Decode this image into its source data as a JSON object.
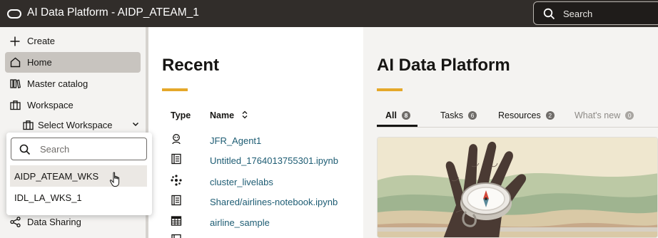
{
  "header": {
    "app_title": "AI Data Platform - AIDP_ATEAM_1",
    "search_placeholder": "Search"
  },
  "sidebar": {
    "items": [
      {
        "label": "Create",
        "icon": "plus-icon"
      },
      {
        "label": "Home",
        "icon": "home-icon",
        "active": true
      },
      {
        "label": "Master catalog",
        "icon": "catalog-icon"
      },
      {
        "label": "Workspace",
        "icon": "workspace-icon"
      }
    ],
    "workspace_select_label": "Select Workspace",
    "data_sharing_label": "Data Sharing"
  },
  "workspace_dropdown": {
    "search_placeholder": "Search",
    "options": [
      "AIDP_ATEAM_WKS",
      "IDL_LA_WKS_1"
    ],
    "hovered_option": "AIDP_ATEAM_WKS"
  },
  "recent": {
    "title": "Recent",
    "columns": {
      "type": "Type",
      "name": "Name"
    },
    "rows": [
      {
        "type_icon": "agent-icon",
        "name": "JFR_Agent1"
      },
      {
        "type_icon": "notebook-icon",
        "name": "Untitled_1764013755301.ipynb"
      },
      {
        "type_icon": "cluster-icon",
        "name": "cluster_livelabs"
      },
      {
        "type_icon": "notebook-icon",
        "name": "Shared/airlines-notebook.ipynb"
      },
      {
        "type_icon": "table-icon",
        "name": "airline_sample"
      }
    ]
  },
  "platform": {
    "title": "AI Data Platform",
    "tabs": [
      {
        "label": "All",
        "count": "8",
        "active": true
      },
      {
        "label": "Tasks",
        "count": "6"
      },
      {
        "label": "Resources",
        "count": "2"
      },
      {
        "label": "What's new",
        "count": "0",
        "muted": true
      }
    ],
    "card_image": "hand-holding-compass-illustration"
  },
  "colors": {
    "topbar": "#312d2a",
    "accent": "#e5a82a",
    "link": "#1d5c73",
    "active_nav": "#c8c4bf"
  }
}
